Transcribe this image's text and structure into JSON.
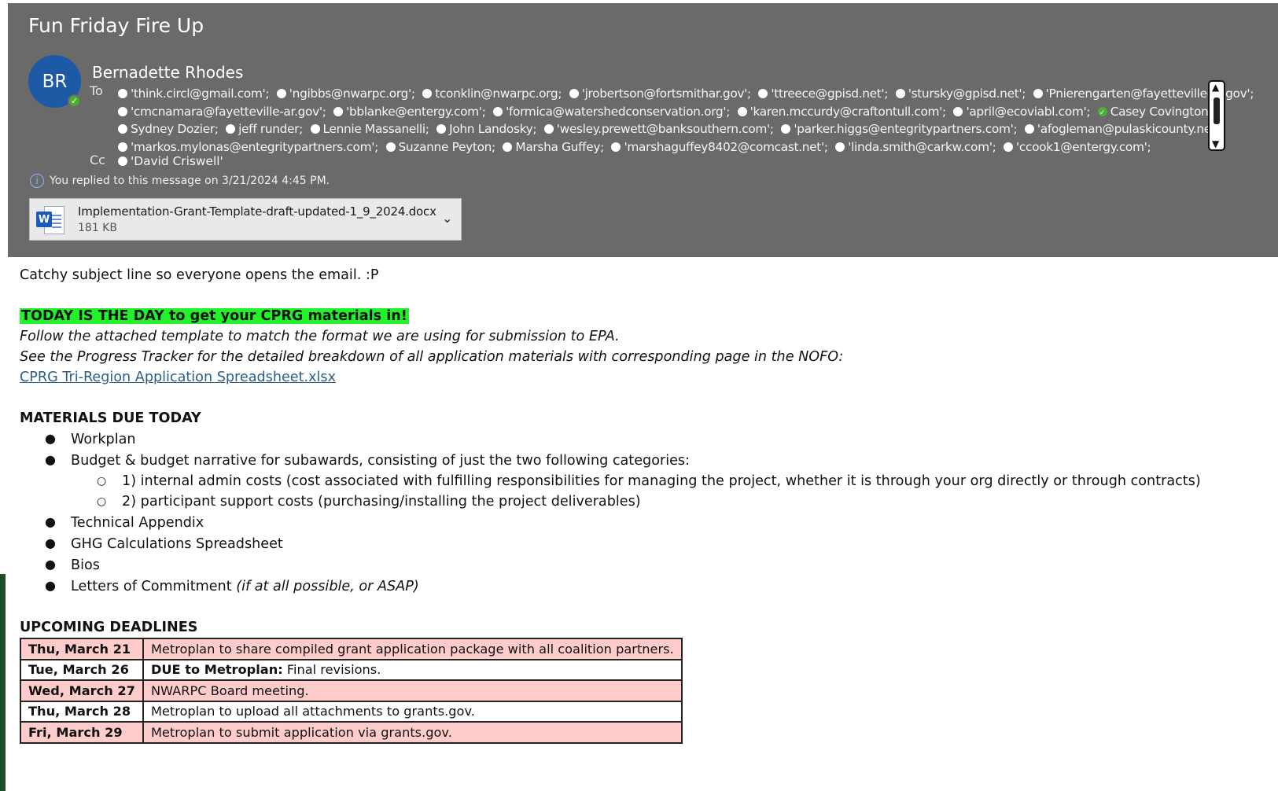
{
  "email": {
    "subject": "Fun Friday Fire Up",
    "avatar_initials": "BR",
    "sender": "Bernadette Rhodes",
    "to_label": "To",
    "cc_label": "Cc",
    "to_recipients": [
      [
        "'think.circl@gmail.com';",
        "'ngibbs@nwarpc.org';",
        "tconklin@nwarpc.org;",
        "'jrobertson@fortsmithar.gov';",
        "'ttreece@gpisd.net';",
        "'stursky@gpisd.net';",
        "'Pnierengarten@fayetteville-ar.gov';"
      ],
      [
        "'cmcnamara@fayetteville-ar.gov';",
        "'bblanke@entergy.com';",
        "'formica@watershedconservation.org';",
        "'karen.mccurdy@craftontull.com';",
        "'april@ecoviabl.com';",
        "Casey Covington;"
      ],
      [
        "Sydney Dozier;",
        "jeff runder;",
        "Lennie Massanelli;",
        "John Landosky;",
        "'wesley.prewett@banksouthern.com';",
        "'parker.higgs@entegritypartners.com';",
        "'afogleman@pulaskicounty.net';"
      ],
      [
        "'markos.mylonas@entegritypartners.com';",
        "Suzanne Peyton;",
        "Marsha Guffey;",
        "'marshaguffey8402@comcast.net';",
        "'linda.smith@carkw.com';",
        "'ccook1@entergy.com';"
      ]
    ],
    "cc_recipients": [
      "'David Criswell'"
    ],
    "reply_info": "You replied to this message on 3/21/2024 4:45 PM.",
    "attachment": {
      "name": "Implementation-Grant-Template-draft-updated-1_9_2024.docx",
      "size": "181 KB"
    }
  },
  "body": {
    "intro": "Catchy subject line so everyone opens the email. :P",
    "highlight": "TODAY IS THE DAY to get your CPRG materials in!",
    "instruction1": "Follow the attached template to match the format we are using for submission to EPA.",
    "instruction2": "See the Progress Tracker for the detailed breakdown of all application materials with corresponding page in the NOFO:",
    "link": "CPRG Tri-Region Application Spreadsheet.xlsx",
    "materials_heading": "MATERIALS DUE TODAY",
    "materials": [
      "Workplan",
      "Budget & budget narrative for subawards, consisting of just the two following categories:",
      "Technical Appendix",
      "GHG Calculations Spreadsheet",
      "Bios",
      "Letters of Commitment"
    ],
    "materials_note": "(if at all possible, or ASAP)",
    "sub_items": [
      "1) internal admin costs (cost associated with fulfilling responsibilities for managing the project, whether it is through your org directly or through contracts)",
      "2) participant support costs (purchasing/installing the project deliverables)"
    ],
    "deadlines_heading": "UPCOMING DEADLINES",
    "deadlines": [
      {
        "date": "Thu, March 21",
        "prefix": "",
        "text": "Metroplan to share compiled grant application package with all coalition partners."
      },
      {
        "date": "Tue, March 26",
        "prefix": "DUE to Metroplan:",
        "text": " Final revisions."
      },
      {
        "date": "Wed, March 27",
        "prefix": "",
        "text": "NWARPC Board meeting."
      },
      {
        "date": "Thu, March 28",
        "prefix": "",
        "text": "Metroplan to upload all attachments to grants.gov."
      },
      {
        "date": "Fri, March 29",
        "prefix": "",
        "text": "Metroplan to submit application via grants.gov."
      }
    ]
  }
}
